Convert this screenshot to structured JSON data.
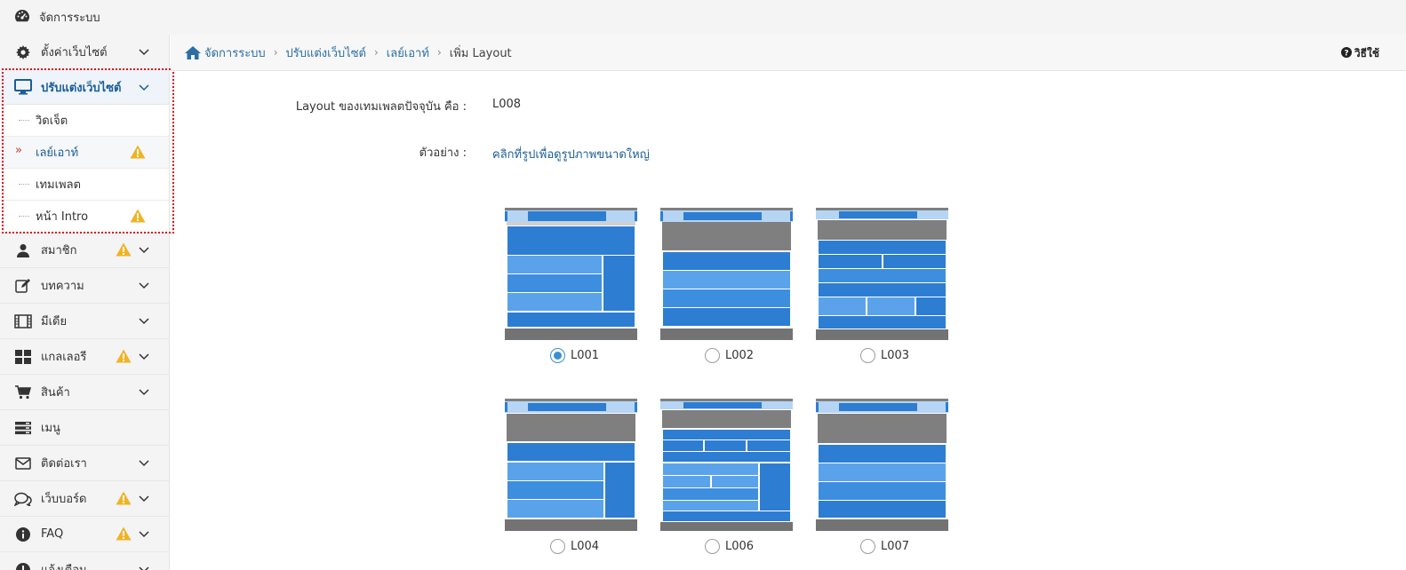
{
  "topbar": {
    "title": "จัดการระบบ",
    "icon": "dashboard-icon"
  },
  "sidebar": {
    "items": [
      {
        "label": "ตั้งค่าเว็บไซต์",
        "icon": "gear-icon",
        "warn": false
      },
      {
        "label": "ปรับแต่งเว็บไซต์",
        "icon": "monitor-icon",
        "warn": false,
        "active": true
      },
      {
        "label": "สมาชิก",
        "icon": "user-icon",
        "warn": true
      },
      {
        "label": "บทความ",
        "icon": "edit-icon",
        "warn": false
      },
      {
        "label": "มีเดีย",
        "icon": "film-icon",
        "warn": false
      },
      {
        "label": "แกลเลอรี",
        "icon": "grid-icon",
        "warn": true
      },
      {
        "label": "สินค้า",
        "icon": "cart-icon",
        "warn": false
      },
      {
        "label": "เมนู",
        "icon": "menu-icon",
        "warn": false
      },
      {
        "label": "ติดต่อเรา",
        "icon": "envelope-icon",
        "warn": false
      },
      {
        "label": "เว็บบอร์ด",
        "icon": "chat-icon",
        "warn": true
      },
      {
        "label": "FAQ",
        "icon": "info-icon",
        "warn": true
      },
      {
        "label": "แจ้งเตือน",
        "icon": "alert-icon",
        "warn": false
      }
    ],
    "subitems": [
      {
        "label": "วิดเจ็ต",
        "warn": false
      },
      {
        "label": "เลย์เอาท์",
        "warn": true,
        "current": true
      },
      {
        "label": "เทมเพลต",
        "warn": false
      },
      {
        "label": "หน้า Intro",
        "warn": true
      }
    ]
  },
  "breadcrumb": {
    "items": [
      "จัดการระบบ",
      "ปรับแต่งเว็บไซต์",
      "เลย์เอาท์",
      "เพิ่ม Layout"
    ],
    "help_label": "วิธีใช้"
  },
  "form": {
    "current_label": "Layout ของเทมเพลตปัจจุบัน คือ :",
    "current_value": "L008",
    "example_label": "ตัวอย่าง :",
    "example_link": "คลิกที่รูปเพื่อดูรูปภาพขนาดใหญ่"
  },
  "layouts": [
    {
      "code": "L001",
      "selected": true
    },
    {
      "code": "L002",
      "selected": false
    },
    {
      "code": "L003",
      "selected": false
    },
    {
      "code": "L004",
      "selected": false
    },
    {
      "code": "L006",
      "selected": false
    },
    {
      "code": "L007",
      "selected": false
    }
  ],
  "colors": {
    "accent": "#1b5d96",
    "warning": "#f0b323",
    "blue": "#2d7dd2",
    "lightblue": "#5aa3ea",
    "gray": "#7f7f7f"
  }
}
